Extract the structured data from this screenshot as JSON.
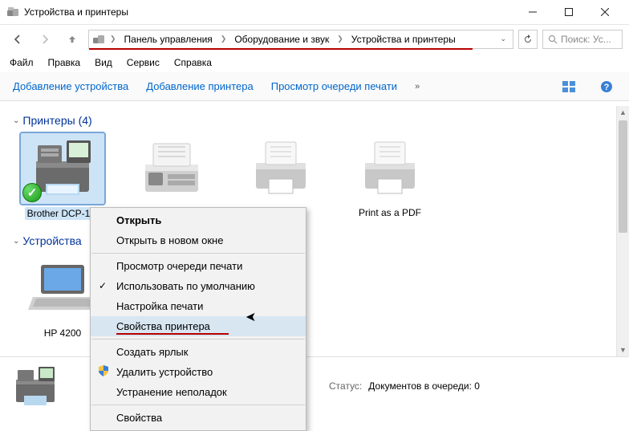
{
  "window": {
    "title": "Устройства и принтеры"
  },
  "breadcrumb": {
    "items": [
      "Панель управления",
      "Оборудование и звук",
      "Устройства и принтеры"
    ]
  },
  "search": {
    "placeholder": "Поиск: Ус..."
  },
  "menubar": {
    "file": "Файл",
    "edit": "Правка",
    "view": "Вид",
    "service": "Сервис",
    "help": "Справка"
  },
  "toolbar": {
    "add_device": "Добавление устройства",
    "add_printer": "Добавление принтера",
    "view_queue": "Просмотр очереди печати"
  },
  "sections": {
    "printers": {
      "title": "Принтеры (4)"
    },
    "devices": {
      "title": "Устройства"
    }
  },
  "printers": [
    {
      "label": "Brother DCP-1..."
    },
    {
      "label": ""
    },
    {
      "label": ""
    },
    {
      "label": "Print as a PDF"
    }
  ],
  "devices": [
    {
      "label": "HP 4200"
    }
  ],
  "context": {
    "open": "Открыть",
    "open_new": "Открыть в новом окне",
    "view_queue": "Просмотр очереди печати",
    "use_default": "Использовать по умолчанию",
    "print_settings": "Настройка печати",
    "printer_props": "Свойства принтера",
    "create_shortcut": "Создать ярлык",
    "remove": "Удалить устройство",
    "troubleshoot": "Устранение неполадок",
    "properties": "Свойства"
  },
  "status": {
    "status_label": "Статус:",
    "status_value": "Документов в очереди: 0"
  }
}
